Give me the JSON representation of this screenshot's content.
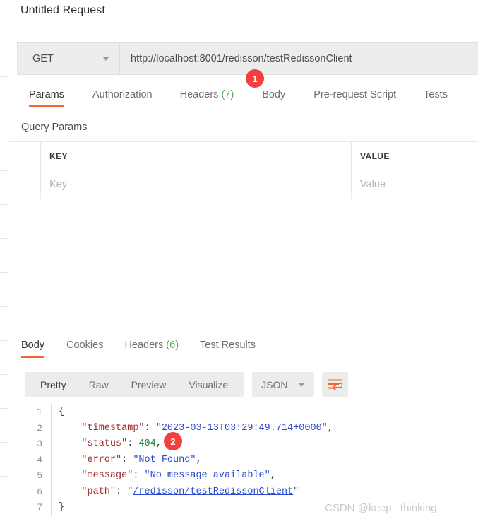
{
  "request": {
    "title": "Untitled Request",
    "method": "GET",
    "url": "http://localhost:8001/redisson/testRedissonClient",
    "tabs": [
      {
        "label": "Params",
        "count": "",
        "active": true
      },
      {
        "label": "Authorization",
        "count": "",
        "active": false
      },
      {
        "label": "Headers",
        "count": "(7)",
        "active": false
      },
      {
        "label": "Body",
        "count": "",
        "active": false
      },
      {
        "label": "Pre-request Script",
        "count": "",
        "active": false
      },
      {
        "label": "Tests",
        "count": "",
        "active": false
      }
    ],
    "query_params": {
      "section_title": "Query Params",
      "columns": [
        "KEY",
        "VALUE"
      ],
      "rows": [
        {
          "key_placeholder": "Key",
          "value_placeholder": "Value"
        }
      ]
    }
  },
  "response": {
    "tabs": [
      {
        "label": "Body",
        "count": "",
        "active": true
      },
      {
        "label": "Cookies",
        "count": "",
        "active": false
      },
      {
        "label": "Headers",
        "count": "(6)",
        "active": false
      },
      {
        "label": "Test Results",
        "count": "",
        "active": false
      }
    ],
    "view_modes": [
      {
        "label": "Pretty",
        "active": true
      },
      {
        "label": "Raw",
        "active": false
      },
      {
        "label": "Preview",
        "active": false
      },
      {
        "label": "Visualize",
        "active": false
      }
    ],
    "language": "JSON",
    "wrap_icon": "wrap-lines-icon",
    "body_lines": [
      {
        "no": "1",
        "segments": [
          {
            "t": "{",
            "c": "punc"
          }
        ]
      },
      {
        "no": "2",
        "segments": [
          {
            "t": "    ",
            "c": "punc"
          },
          {
            "t": "\"timestamp\"",
            "c": "key"
          },
          {
            "t": ": ",
            "c": "punc"
          },
          {
            "t": "\"2023-03-13T03:29:49.714+0000\"",
            "c": "str"
          },
          {
            "t": ",",
            "c": "punc"
          }
        ]
      },
      {
        "no": "3",
        "segments": [
          {
            "t": "    ",
            "c": "punc"
          },
          {
            "t": "\"status\"",
            "c": "key"
          },
          {
            "t": ": ",
            "c": "punc"
          },
          {
            "t": "404",
            "c": "num"
          },
          {
            "t": ",",
            "c": "punc"
          }
        ]
      },
      {
        "no": "4",
        "segments": [
          {
            "t": "    ",
            "c": "punc"
          },
          {
            "t": "\"error\"",
            "c": "key"
          },
          {
            "t": ": ",
            "c": "punc"
          },
          {
            "t": "\"Not Found\"",
            "c": "str"
          },
          {
            "t": ",",
            "c": "punc"
          }
        ]
      },
      {
        "no": "5",
        "segments": [
          {
            "t": "    ",
            "c": "punc"
          },
          {
            "t": "\"message\"",
            "c": "key"
          },
          {
            "t": ": ",
            "c": "punc"
          },
          {
            "t": "\"No message available\"",
            "c": "str"
          },
          {
            "t": ",",
            "c": "punc"
          }
        ]
      },
      {
        "no": "6",
        "segments": [
          {
            "t": "    ",
            "c": "punc"
          },
          {
            "t": "\"path\"",
            "c": "key"
          },
          {
            "t": ": ",
            "c": "punc"
          },
          {
            "t": "\"",
            "c": "str"
          },
          {
            "t": "/redisson/testRedissonClient",
            "c": "link"
          },
          {
            "t": "\"",
            "c": "str"
          }
        ]
      },
      {
        "no": "7",
        "segments": [
          {
            "t": "}",
            "c": "punc"
          }
        ]
      }
    ]
  },
  "annotations": [
    {
      "id": "1",
      "label": "1"
    },
    {
      "id": "2",
      "label": "2"
    }
  ],
  "watermark": "CSDN @keep   thinking",
  "colors": {
    "accent": "#ef6633",
    "badge": "#f43f3f",
    "count": "#4caf50",
    "toolbar_bg": "#ececec",
    "json_key": "#a03030",
    "json_string": "#2b4ad0",
    "json_number": "#1a8a3a"
  }
}
